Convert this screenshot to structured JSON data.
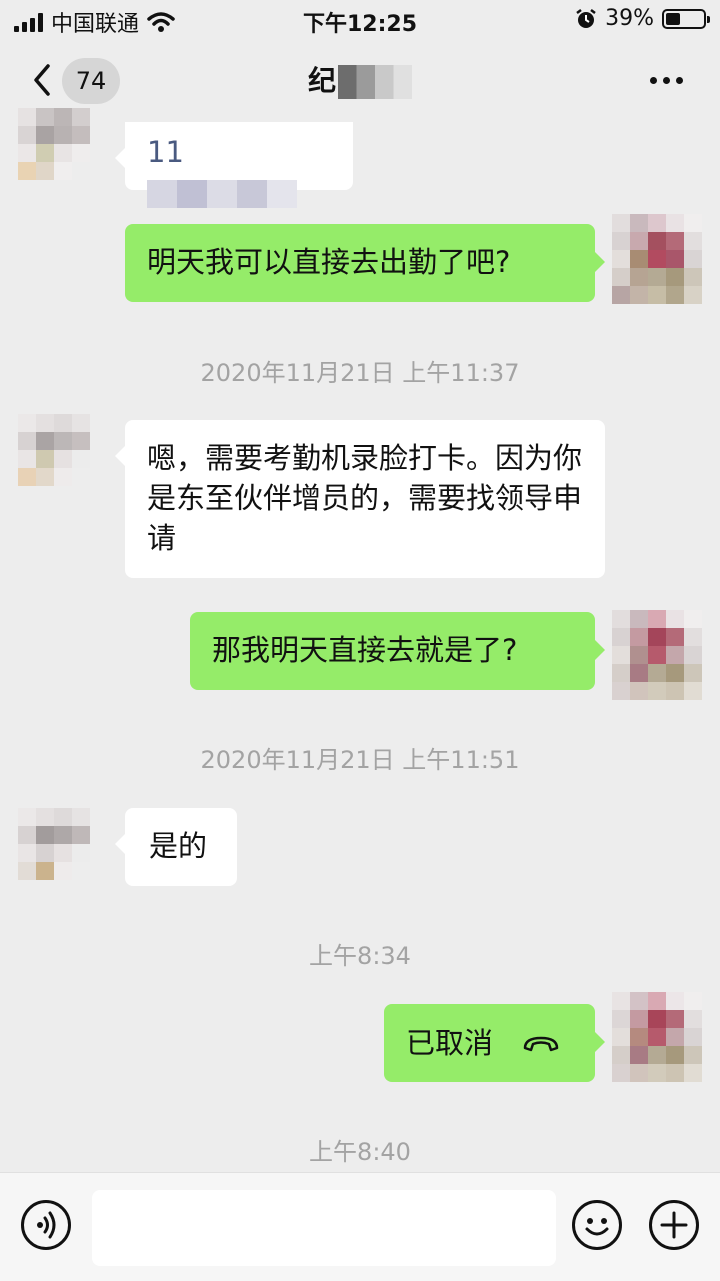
{
  "status_bar": {
    "carrier": "中国联通",
    "time": "下午12:25",
    "battery": "39%"
  },
  "nav": {
    "unread_count": "74",
    "contact_name": "纪"
  },
  "messages": {
    "m1_text": "11",
    "m2_text": "明天我可以直接去出勤了吧?",
    "ts1": "2020年11月21日 上午11:37",
    "m3_text": "嗯，需要考勤机录脸打卡。因为你是东至伙伴增员的，需要找领导申请",
    "m4_text": "那我明天直接去就是了?",
    "ts2": "2020年11月21日 上午11:51",
    "m5_text": "是的",
    "ts3": "上午8:34",
    "m6_text": "已取消",
    "ts4": "上午8:40"
  },
  "colors": {
    "accent_green": "#95ec69",
    "background": "#ededed"
  }
}
